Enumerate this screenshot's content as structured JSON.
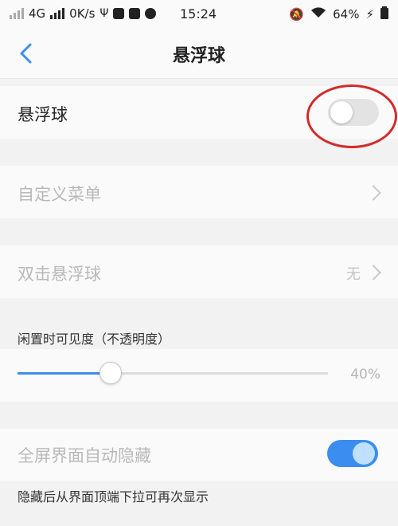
{
  "status_bar": {
    "network": "4G",
    "speed": "0K/s",
    "time": "15:24",
    "battery": "64%"
  },
  "header": {
    "title": "悬浮球",
    "back_icon": "chevron-left-icon"
  },
  "floating_ball": {
    "label": "悬浮球",
    "enabled": false
  },
  "custom_menu": {
    "label": "自定义菜单"
  },
  "double_tap": {
    "label": "双击悬浮球",
    "value": "无"
  },
  "idle_visibility": {
    "label": "闲置时可见度（不透明度）",
    "value": "40%",
    "level": 0.3
  },
  "fullscreen_hide": {
    "label": "全屏界面自动隐藏",
    "enabled": true,
    "description": "隐藏后从界面顶端下拉可再次显示"
  },
  "colors": {
    "accent": "#3b8ef0",
    "annotation": "#d42a2a"
  }
}
